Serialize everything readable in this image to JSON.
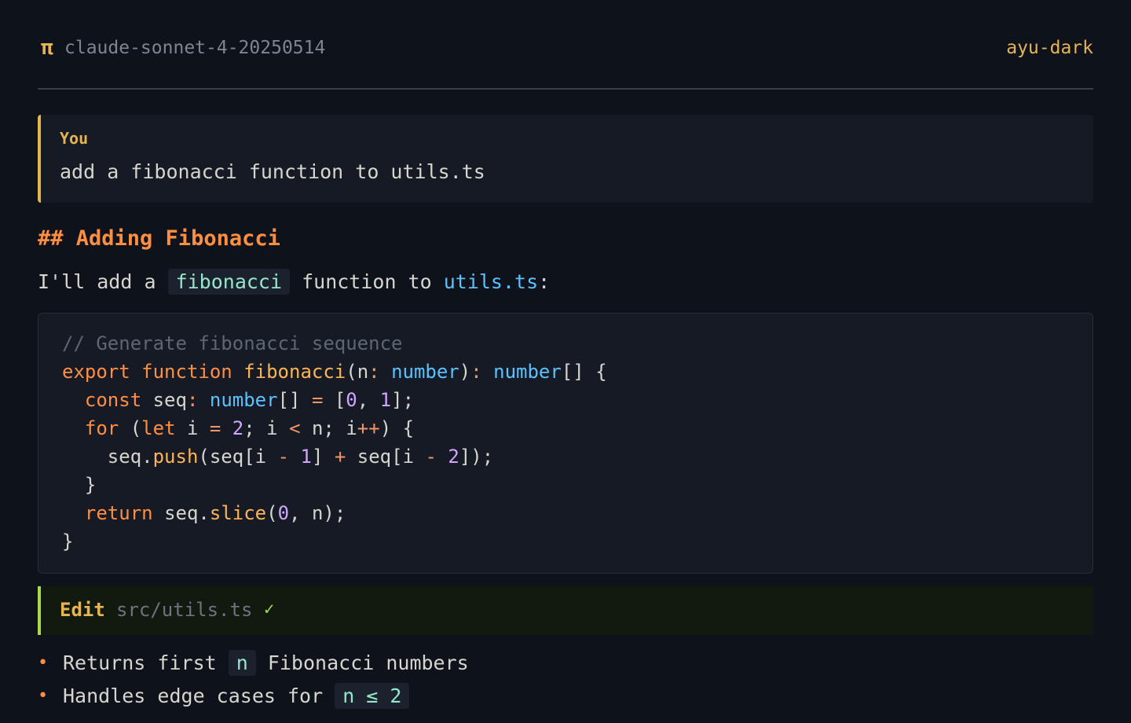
{
  "header": {
    "model": "claude-sonnet-4-20250514",
    "theme": "ayu-dark"
  },
  "user_message": {
    "label": "You",
    "text": "add a fibonacci function to utils.ts"
  },
  "assistant": {
    "heading": "## Adding Fibonacci",
    "intro": {
      "prefix": "I'll add a ",
      "code": "fibonacci",
      "middle": " function to ",
      "file": "utils.ts",
      "suffix": ":"
    },
    "code_lines": [
      "// Generate fibonacci sequence",
      "export function fibonacci(n: number): number[] {",
      "  const seq: number[] = [0, 1];",
      "  for (let i = 2; i < n; i++) {",
      "    seq.push(seq[i - 1] + seq[i - 2]);",
      "  }",
      "  return seq.slice(0, n);",
      "}"
    ],
    "tool": {
      "name": "Edit",
      "path": "src/utils.ts",
      "status": "✓"
    },
    "bullets": [
      {
        "prefix": "Returns first ",
        "code": "n",
        "suffix": " Fibonacci numbers"
      },
      {
        "prefix": "Handles edge cases for ",
        "code": "n ≤ 2",
        "suffix": ""
      }
    ]
  },
  "colors": {
    "background": "#0e121a",
    "accent": "#e6b450",
    "keyword": "#ff8f40",
    "type": "#59c2ff",
    "number": "#d2a6ff",
    "success": "#aad94c",
    "inline_code": "#95e6cb"
  }
}
